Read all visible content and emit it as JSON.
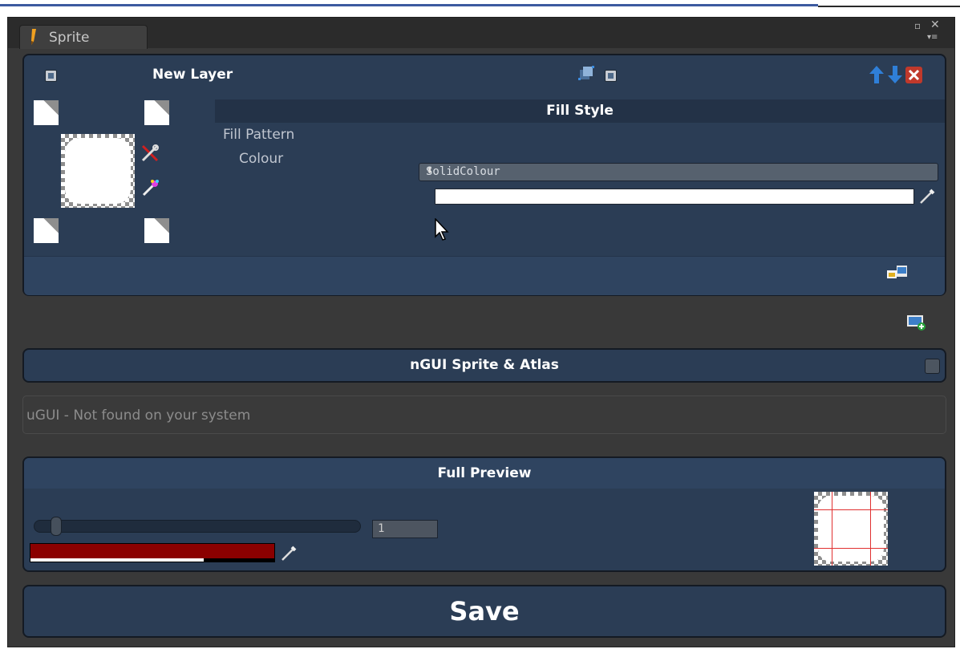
{
  "window": {
    "tab_title": "Sprite",
    "maximize_glyph": "▫",
    "close_glyph": "✕",
    "menu_glyph": "▾≡"
  },
  "layer": {
    "name": "New Layer",
    "enabled": true,
    "fill_style_header": "Fill Style",
    "fill_pattern_label": "Fill Pattern",
    "fill_pattern_value": "SolidColour",
    "fill_pattern_arrow": "⬍",
    "colour_label": "Colour",
    "colour_value": "#ffffff"
  },
  "ngui": {
    "title": "nGUI Sprite & Atlas",
    "enabled": false
  },
  "ugui": {
    "message": "uGUI - Not found on your system"
  },
  "preview": {
    "title": "Full Preview",
    "zoom_value": "1",
    "zoom_slider": 0.0,
    "background_colour": "#8b0000",
    "alpha_level": 0.71
  },
  "save_label": "Save",
  "icons": {
    "move_up": "arrow-up-icon",
    "move_down": "arrow-down-icon",
    "delete": "delete-icon",
    "eyedropper": "eyedropper-icon"
  },
  "colors": {
    "accent_blue": "#2f7fd8",
    "delete_red": "#c0392b",
    "panel": "#2b3d55"
  }
}
